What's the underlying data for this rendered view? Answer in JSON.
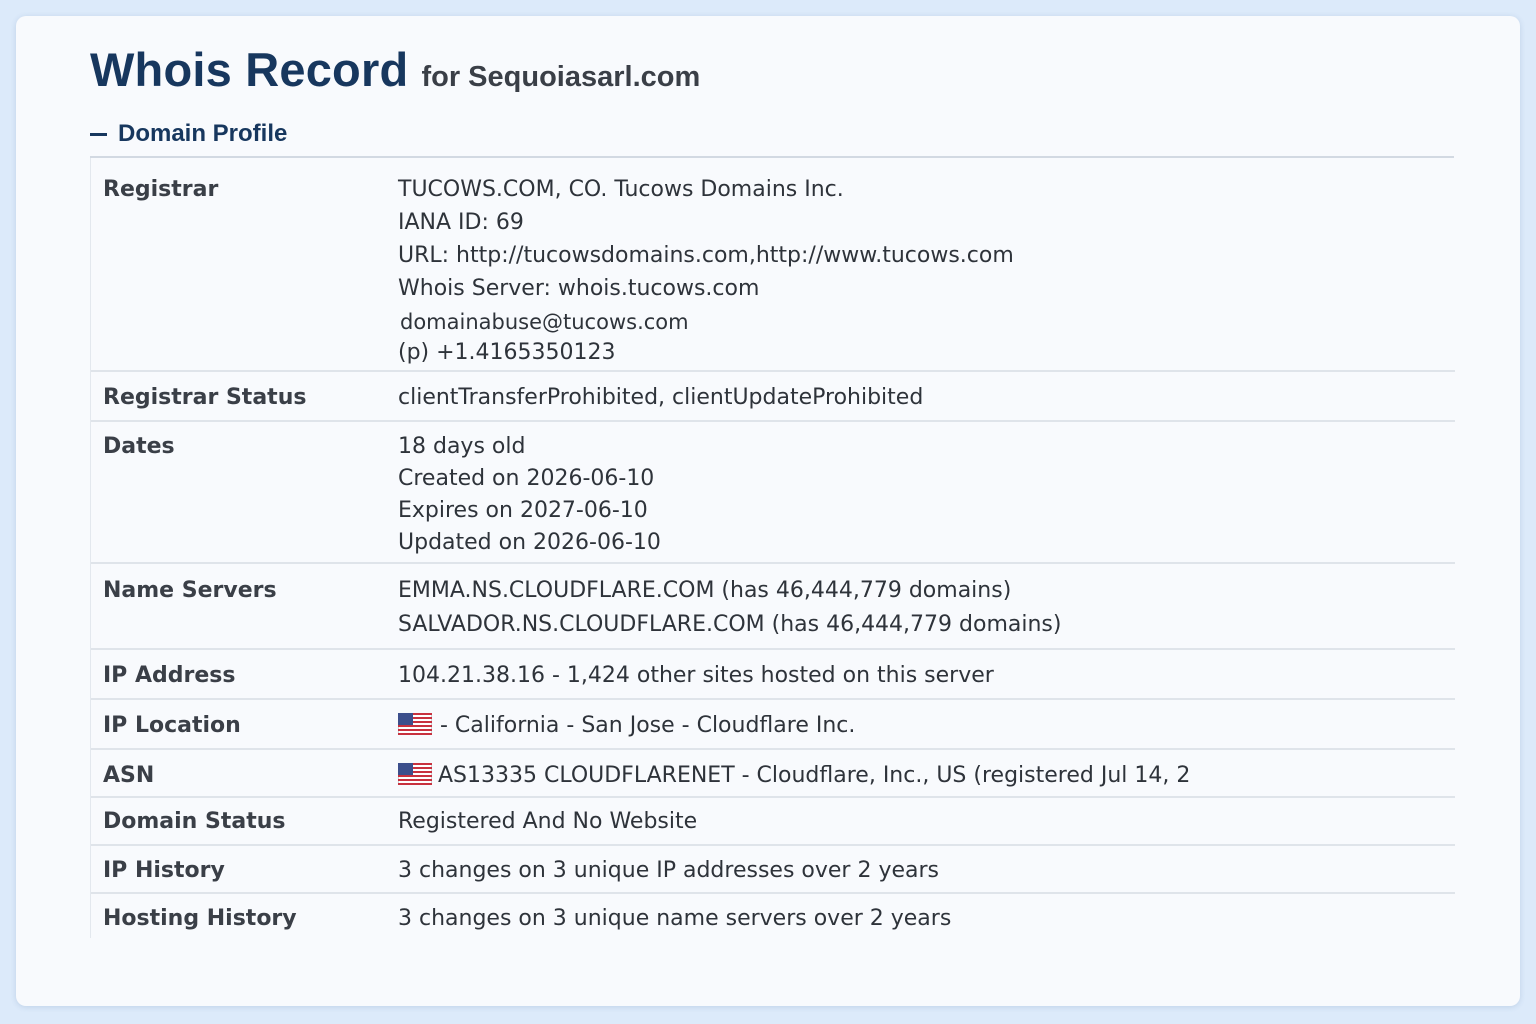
{
  "header": {
    "title": "Whois Record",
    "subtitle": "for Sequoiasarl.com"
  },
  "section": {
    "title": "Domain Profile",
    "toggle_icon": "collapse-minus-icon"
  },
  "profile": {
    "registrar": {
      "label": "Registrar",
      "name": "TUCOWS.COM, CO. Tucows Domains Inc.",
      "iana_id": "IANA ID: 69",
      "url": "URL: http://tucowsdomains.com,http://www.tucows.com",
      "whois_server": "Whois Server: whois.tucows.com",
      "email": "domainabuse@tucows.com",
      "phone": "(p) +1.4165350123"
    },
    "registrar_status": {
      "label": "Registrar Status",
      "value": "clientTransferProhibited, clientUpdateProhibited"
    },
    "dates": {
      "label": "Dates",
      "age": "18 days old",
      "created": "Created on 2026-06-10",
      "expires": "Expires on 2027-06-10",
      "updated": "Updated on 2026-06-10"
    },
    "name_servers": {
      "label": "Name Servers",
      "servers": [
        "EMMA.NS.CLOUDFLARE.COM (has 46,444,779 domains)",
        "SALVADOR.NS.CLOUDFLARE.COM (has 46,444,779 domains)"
      ]
    },
    "ip_address": {
      "label": "IP Address",
      "value": "104.21.38.16 - 1,424 other sites hosted on this server"
    },
    "ip_location": {
      "label": "IP Location",
      "flag_icon": "us-flag-icon",
      "value": "- California - San Jose - Cloudflare Inc."
    },
    "asn": {
      "label": "ASN",
      "flag_icon": "us-flag-icon",
      "value": "AS13335 CLOUDFLARENET - Cloudflare, Inc., US (registered Jul 14, 2"
    },
    "domain_status": {
      "label": "Domain Status",
      "value": "Registered And No Website"
    },
    "ip_history": {
      "label": "IP History",
      "value": "3 changes on 3 unique IP addresses over 2 years"
    },
    "hosting_history": {
      "label": "Hosting History",
      "value": "3 changes on 3 unique name servers over 2 years"
    }
  },
  "colors": {
    "page_background": "#dceafa",
    "card_background": "#f8fafd",
    "heading": "#17375e",
    "label_text": "#3a3f47",
    "value_text": "#2e333a",
    "row_divider": "#dfe4ea"
  }
}
